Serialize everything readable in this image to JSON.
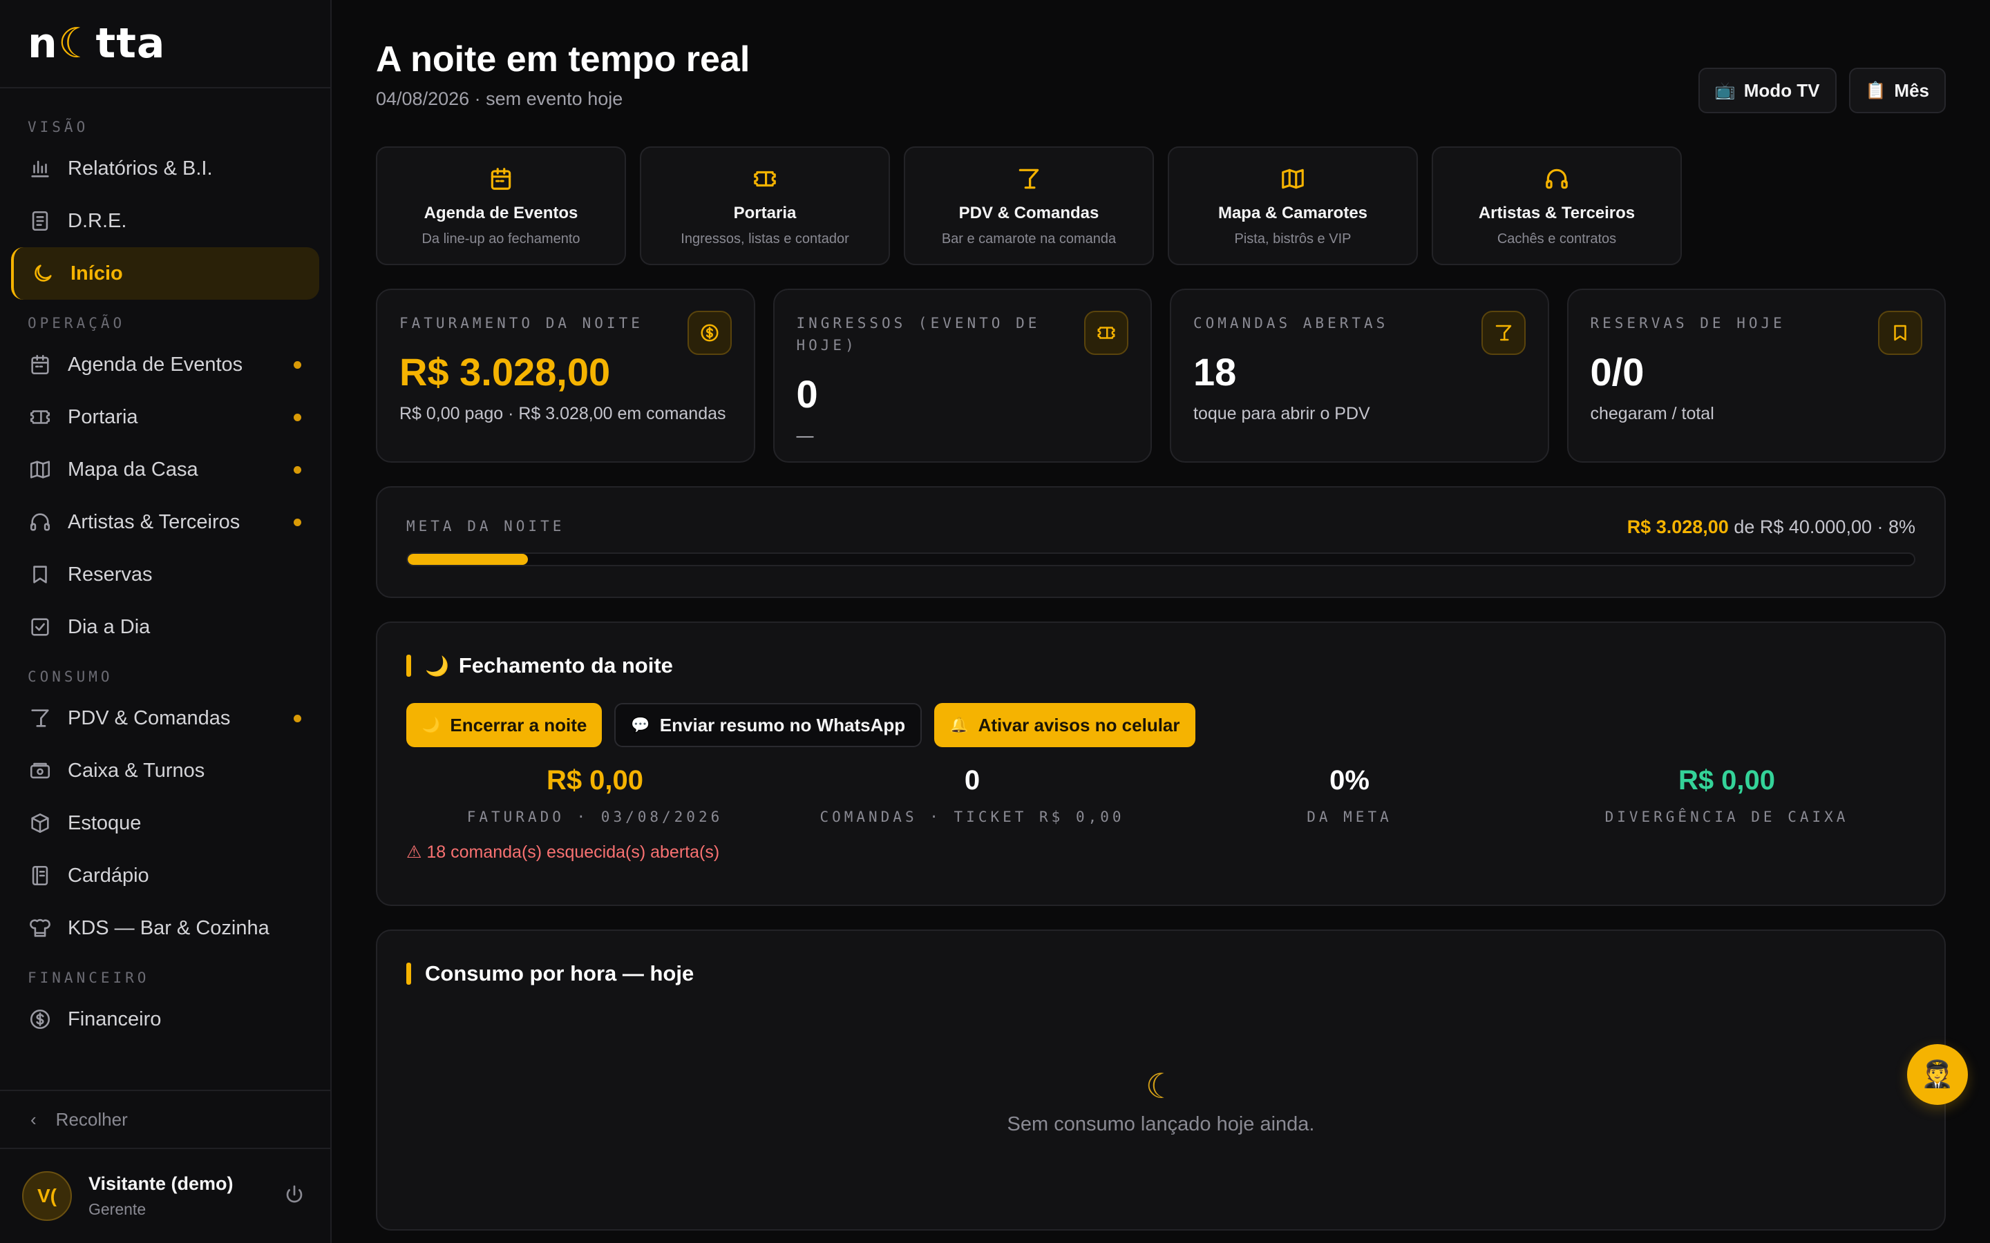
{
  "brand": {
    "logo_pre": "n",
    "logo_moon": "☾",
    "logo_post": "tta"
  },
  "sidebar": {
    "sections": [
      {
        "title": "VISÃO",
        "items": [
          {
            "label": "Relatórios & B.I.",
            "icon": "bar-chart-icon",
            "dot": false,
            "active": false
          },
          {
            "label": "D.R.E.",
            "icon": "document-icon",
            "dot": false,
            "active": false
          },
          {
            "label": "Início",
            "icon": "moon-icon",
            "dot": false,
            "active": true
          }
        ]
      },
      {
        "title": "OPERAÇÃO",
        "items": [
          {
            "label": "Agenda de Eventos",
            "icon": "calendar-icon",
            "dot": true
          },
          {
            "label": "Portaria",
            "icon": "ticket-icon",
            "dot": true
          },
          {
            "label": "Mapa da Casa",
            "icon": "map-icon",
            "dot": true
          },
          {
            "label": "Artistas & Terceiros",
            "icon": "headphones-icon",
            "dot": true
          },
          {
            "label": "Reservas",
            "icon": "bookmark-icon",
            "dot": false
          },
          {
            "label": "Dia a Dia",
            "icon": "check-square-icon",
            "dot": false
          }
        ]
      },
      {
        "title": "CONSUMO",
        "items": [
          {
            "label": "PDV & Comandas",
            "icon": "cocktail-icon",
            "dot": true
          },
          {
            "label": "Caixa & Turnos",
            "icon": "cash-icon",
            "dot": false
          },
          {
            "label": "Estoque",
            "icon": "box-icon",
            "dot": false
          },
          {
            "label": "Cardápio",
            "icon": "menu-book-icon",
            "dot": false
          },
          {
            "label": "KDS — Bar & Cozinha",
            "icon": "chef-hat-icon",
            "dot": false
          }
        ]
      },
      {
        "title": "FINANCEIRO",
        "items": [
          {
            "label": "Financeiro",
            "icon": "dollar-circle-icon",
            "dot": false
          }
        ]
      }
    ],
    "collapse_label": "Recolher",
    "user": {
      "initials": "V(",
      "name": "Visitante (demo)",
      "role": "Gerente"
    }
  },
  "header": {
    "title": "A noite em tempo real",
    "subtitle": "04/08/2026 · sem evento hoje",
    "tv_button": "Modo TV",
    "tv_emoji": "📺",
    "month_button": "Mês",
    "month_emoji": "📋"
  },
  "shortcuts": [
    {
      "title": "Agenda de Eventos",
      "subtitle": "Da line-up ao fechamento",
      "icon": "calendar-icon"
    },
    {
      "title": "Portaria",
      "subtitle": "Ingressos, listas e contador",
      "icon": "ticket-icon"
    },
    {
      "title": "PDV & Comandas",
      "subtitle": "Bar e camarote na comanda",
      "icon": "cocktail-icon"
    },
    {
      "title": "Mapa & Camarotes",
      "subtitle": "Pista, bistrôs e VIP",
      "icon": "map-icon"
    },
    {
      "title": "Artistas & Terceiros",
      "subtitle": "Cachês e contratos",
      "icon": "headphones-icon"
    }
  ],
  "kpis": [
    {
      "label": "FATURAMENTO DA NOITE",
      "value": "R$ 3.028,00",
      "sub": "R$ 0,00 pago · R$ 3.028,00 em comandas",
      "icon": "dollar-circle-icon",
      "gold": true
    },
    {
      "label": "INGRESSOS (EVENTO DE HOJE)",
      "value": "0",
      "sub": "—",
      "icon": "ticket-icon",
      "gold": false
    },
    {
      "label": "COMANDAS ABERTAS",
      "value": "18",
      "sub": "toque para abrir o PDV",
      "icon": "cocktail-icon",
      "gold": false
    },
    {
      "label": "RESERVAS DE HOJE",
      "value": "0/0",
      "sub": "chegaram / total",
      "icon": "bookmark-icon",
      "gold": false
    }
  ],
  "goal": {
    "label": "META DA NOITE",
    "current": "R$ 3.028,00",
    "rest": " de R$ 40.000,00 · 8%",
    "progress": 0.08
  },
  "closing": {
    "title": "Fechamento da noite",
    "title_emoji": "🌙",
    "buttons": [
      {
        "label": "Encerrar a noite",
        "emoji": "🌙",
        "style": "gold"
      },
      {
        "label": "Enviar resumo no WhatsApp",
        "emoji": "💬",
        "style": "dark"
      },
      {
        "label": "Ativar avisos no celular",
        "emoji": "🔔",
        "style": "gold"
      }
    ],
    "stats": [
      {
        "value": "R$ 0,00",
        "label": "FATURADO · 03/08/2026",
        "color": "gold"
      },
      {
        "value": "0",
        "label": "COMANDAS · TICKET R$ 0,00",
        "color": "white"
      },
      {
        "value": "0%",
        "label": "DA META",
        "color": "white"
      },
      {
        "value": "R$ 0,00",
        "label": "DIVERGÊNCIA DE CAIXA",
        "color": "green"
      }
    ],
    "warning": "⚠ 18 comanda(s) esquecida(s) aberta(s)"
  },
  "consumo": {
    "title": "Consumo por hora — hoje",
    "empty_icon": "☾",
    "empty_text": "Sem consumo lançado hoje ainda."
  },
  "fab": {
    "emoji": "🧑‍✈️"
  },
  "colors": {
    "accent": "#f5b301",
    "positive": "#34d399",
    "danger": "#f87171",
    "background": "#0a0a0b"
  }
}
